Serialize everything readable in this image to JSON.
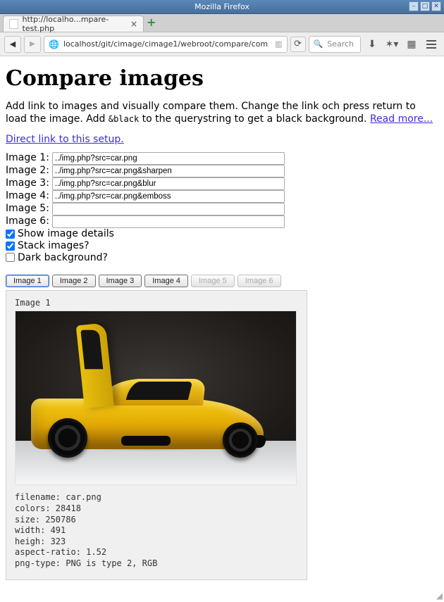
{
  "window": {
    "title": "Mozilla Firefox"
  },
  "tab": {
    "title": "http://localho...mpare-test.php"
  },
  "toolbar": {
    "url": "localhost/git/cimage/cimage1/webroot/compare/com",
    "search_placeholder": "Search"
  },
  "page": {
    "heading": "Compare images",
    "intro_a": "Add link to images and visually compare them. Change the link och press return to load the image. Add ",
    "intro_code": "&black",
    "intro_b": " to the querystring to get a black background. ",
    "intro_link": "Read more...",
    "direct_link": "Direct link to this setup."
  },
  "inputs": {
    "label1": "Image 1:",
    "val1": "../img.php?src=car.png",
    "label2": "Image 2:",
    "val2": "../img.php?src=car.png&sharpen",
    "label3": "Image 3:",
    "val3": "../img.php?src=car.png&blur",
    "label4": "Image 4:",
    "val4": "../img.php?src=car.png&emboss",
    "label5": "Image 5:",
    "val5": "",
    "label6": "Image 6:",
    "val6": ""
  },
  "checks": {
    "show_details": "Show image details",
    "stack": "Stack images?",
    "dark": "Dark background?"
  },
  "tabs": {
    "t1": "Image 1",
    "t2": "Image 2",
    "t3": "Image 3",
    "t4": "Image 4",
    "t5": "Image 5",
    "t6": "Image 6"
  },
  "panel": {
    "label": "Image 1",
    "details": "filename: car.png\ncolors: 28418\nsize: 250786\nwidth: 491\nheigh: 323\naspect-ratio: 1.52\npng-type: PNG is type 2, RGB"
  }
}
